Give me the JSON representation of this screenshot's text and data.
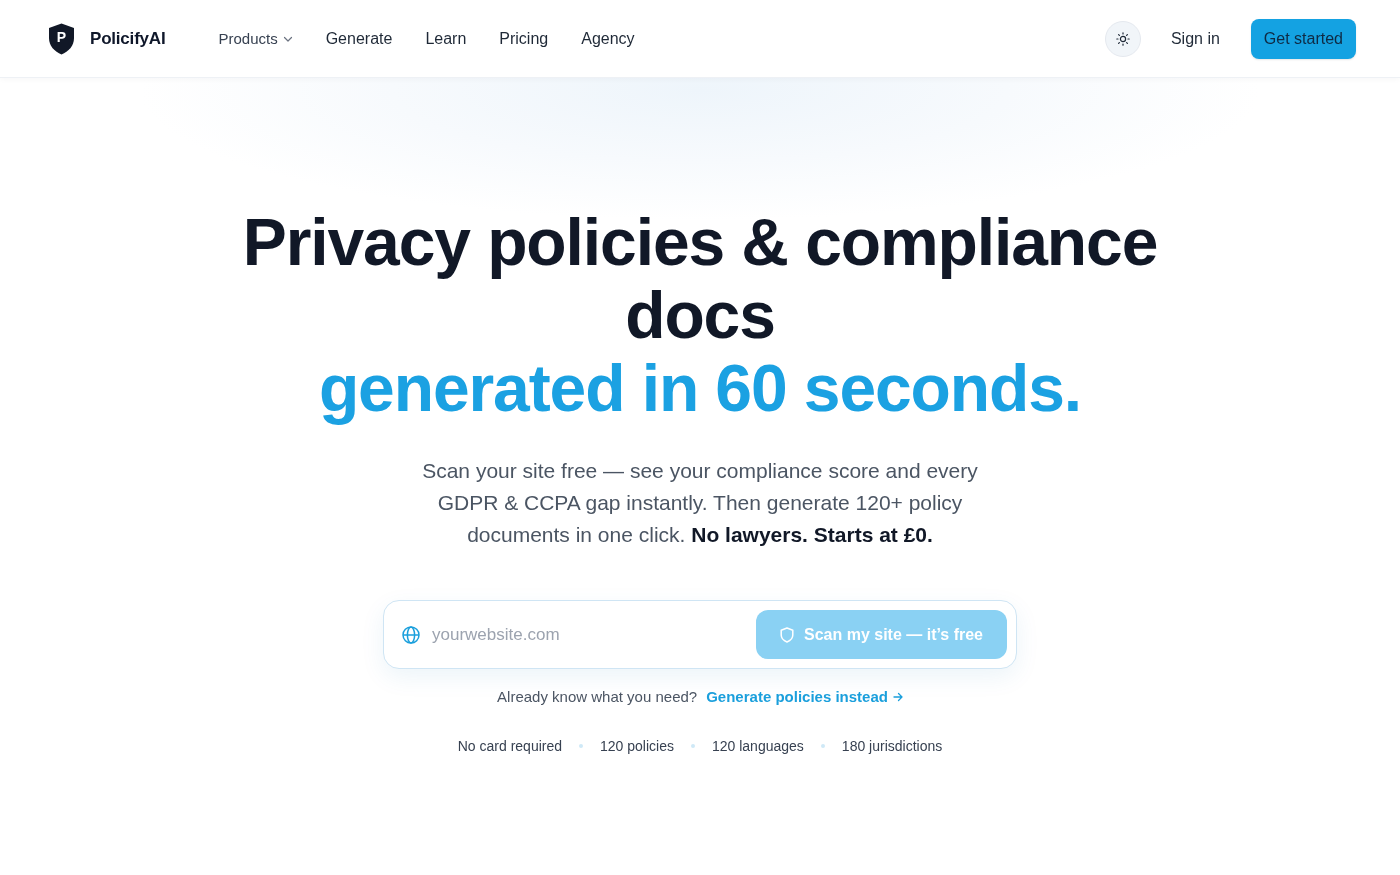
{
  "header": {
    "brand": {
      "mark": "P",
      "name": "PolicifyAI"
    },
    "nav": [
      {
        "label": "Products",
        "kind": "menu"
      },
      {
        "label": "Generate",
        "kind": "link"
      },
      {
        "label": "Learn",
        "kind": "link"
      },
      {
        "label": "Pricing",
        "kind": "link"
      },
      {
        "label": "Agency",
        "kind": "link"
      }
    ],
    "theme_toggle": {
      "dark_mode": false
    },
    "sign_in": "Sign in",
    "cta": "Get started"
  },
  "hero": {
    "title": "Privacy policies & compliance docs",
    "title_accent": "generated in 60 seconds.",
    "subtitle": "Scan your site free — see your compliance score and every GDPR & CCPA gap instantly. Then generate 120+ policy documents in one click. **No lawyers. Starts at £0.**",
    "scan_form": {
      "placeholder": "yourwebsite.com",
      "button": {
        "label": "Scan my site — it’s free",
        "disabled": true
      }
    },
    "alt_prompt": {
      "text": "Already know what you need?",
      "link": "Generate policies instead"
    },
    "trust_items": [
      "No card required",
      "120 policies",
      "120 languages",
      "180 jurisdictions"
    ]
  }
}
